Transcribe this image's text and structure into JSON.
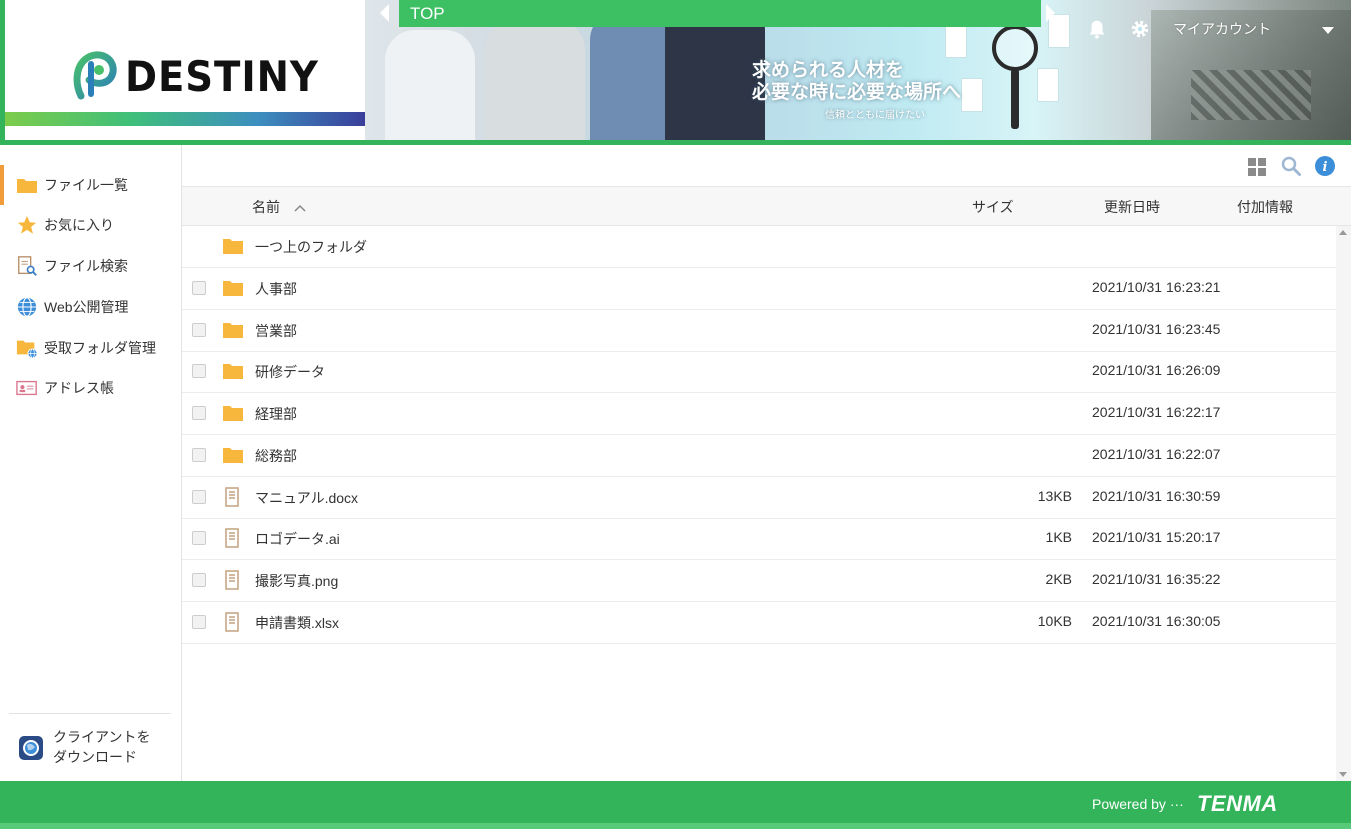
{
  "brand": {
    "name": "DESTINY",
    "accent": "#34b45a",
    "active_marker": "#f29b3b"
  },
  "header": {
    "breadcrumb": "TOP",
    "slogan_line1": "求められる人材を",
    "slogan_line2": "必要な時に必要な場所へ",
    "slogan_sub": "信頼とともに届けたい",
    "account_label": "マイアカウント",
    "icons": [
      "bell-icon",
      "gear-icon",
      "chevron-down-icon"
    ]
  },
  "sidebar": {
    "items": [
      {
        "label": "ファイル一覧",
        "icon": "folder-icon",
        "active": true
      },
      {
        "label": "お気に入り",
        "icon": "star-icon",
        "active": false
      },
      {
        "label": "ファイル検索",
        "icon": "file-search-icon",
        "active": false
      },
      {
        "label": "Web公開管理",
        "icon": "globe-icon",
        "active": false
      },
      {
        "label": "受取フォルダ管理",
        "icon": "folder-globe-icon",
        "active": false
      },
      {
        "label": "アドレス帳",
        "icon": "address-card-icon",
        "active": false
      }
    ],
    "download_line1": "クライアントを",
    "download_line2": "ダウンロード"
  },
  "toolbar": {
    "icons": [
      "grid-view-icon",
      "search-icon",
      "info-icon"
    ]
  },
  "columns": {
    "name": "名前",
    "size": "サイズ",
    "updated": "更新日時",
    "extra": "付加情報",
    "sort": "ascending"
  },
  "parent_folder": "一つ上のフォルダ",
  "files": [
    {
      "name": "人事部",
      "type": "folder",
      "size": "",
      "date": "2021/10/31 16:23:21"
    },
    {
      "name": "営業部",
      "type": "folder",
      "size": "",
      "date": "2021/10/31 16:23:45"
    },
    {
      "name": "研修データ",
      "type": "folder",
      "size": "",
      "date": "2021/10/31 16:26:09"
    },
    {
      "name": "経理部",
      "type": "folder",
      "size": "",
      "date": "2021/10/31 16:22:17"
    },
    {
      "name": "総務部",
      "type": "folder",
      "size": "",
      "date": "2021/10/31 16:22:07"
    },
    {
      "name": "マニュアル.docx",
      "type": "file",
      "size": "13KB",
      "date": "2021/10/31 16:30:59"
    },
    {
      "name": "ロゴデータ.ai",
      "type": "file",
      "size": "1KB",
      "date": "2021/10/31 15:20:17"
    },
    {
      "name": "撮影写真.png",
      "type": "file",
      "size": "2KB",
      "date": "2021/10/31 16:35:22"
    },
    {
      "name": "申請書類.xlsx",
      "type": "file",
      "size": "10KB",
      "date": "2021/10/31 16:30:05"
    }
  ],
  "footer": {
    "powered": "Powered by ···",
    "vendor": "TENMA"
  }
}
